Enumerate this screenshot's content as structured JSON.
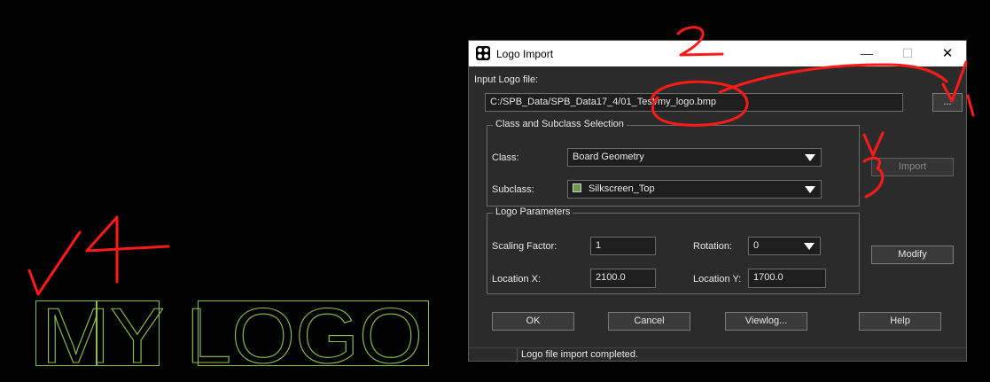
{
  "dialog": {
    "title": "Logo Import",
    "input_label": "Input Logo file:",
    "input_value": "C:/SPB_Data/SPB_Data17_4/01_Test/my_logo.bmp",
    "browse_label": "...",
    "class_group_title": "Class and Subclass Selection",
    "class_label": "Class:",
    "class_value": "Board Geometry",
    "subclass_label": "Subclass:",
    "subclass_value": "Silkscreen_Top",
    "subclass_swatch_color": "#6f9a4c",
    "import_label": "Import",
    "params_group_title": "Logo Parameters",
    "scaling_label": "Scaling Factor:",
    "scaling_value": "1",
    "rotation_label": "Rotation:",
    "rotation_value": "0",
    "locx_label": "Location X:",
    "locx_value": "2100.0",
    "locy_label": "Location Y:",
    "locy_value": "1700.0",
    "modify_label": "Modify",
    "ok_label": "OK",
    "cancel_label": "Cancel",
    "viewlog_label": "Viewlog...",
    "help_label": "Help",
    "status_text": "Logo file import completed."
  },
  "canvas": {
    "logo_text": "MY LOGO",
    "outline_color": "#8ac04a"
  },
  "annotations": {
    "color": "#ff1a1a",
    "number_2": "2",
    "number_4": "4",
    "number_3": "3",
    "number_1": "1"
  }
}
